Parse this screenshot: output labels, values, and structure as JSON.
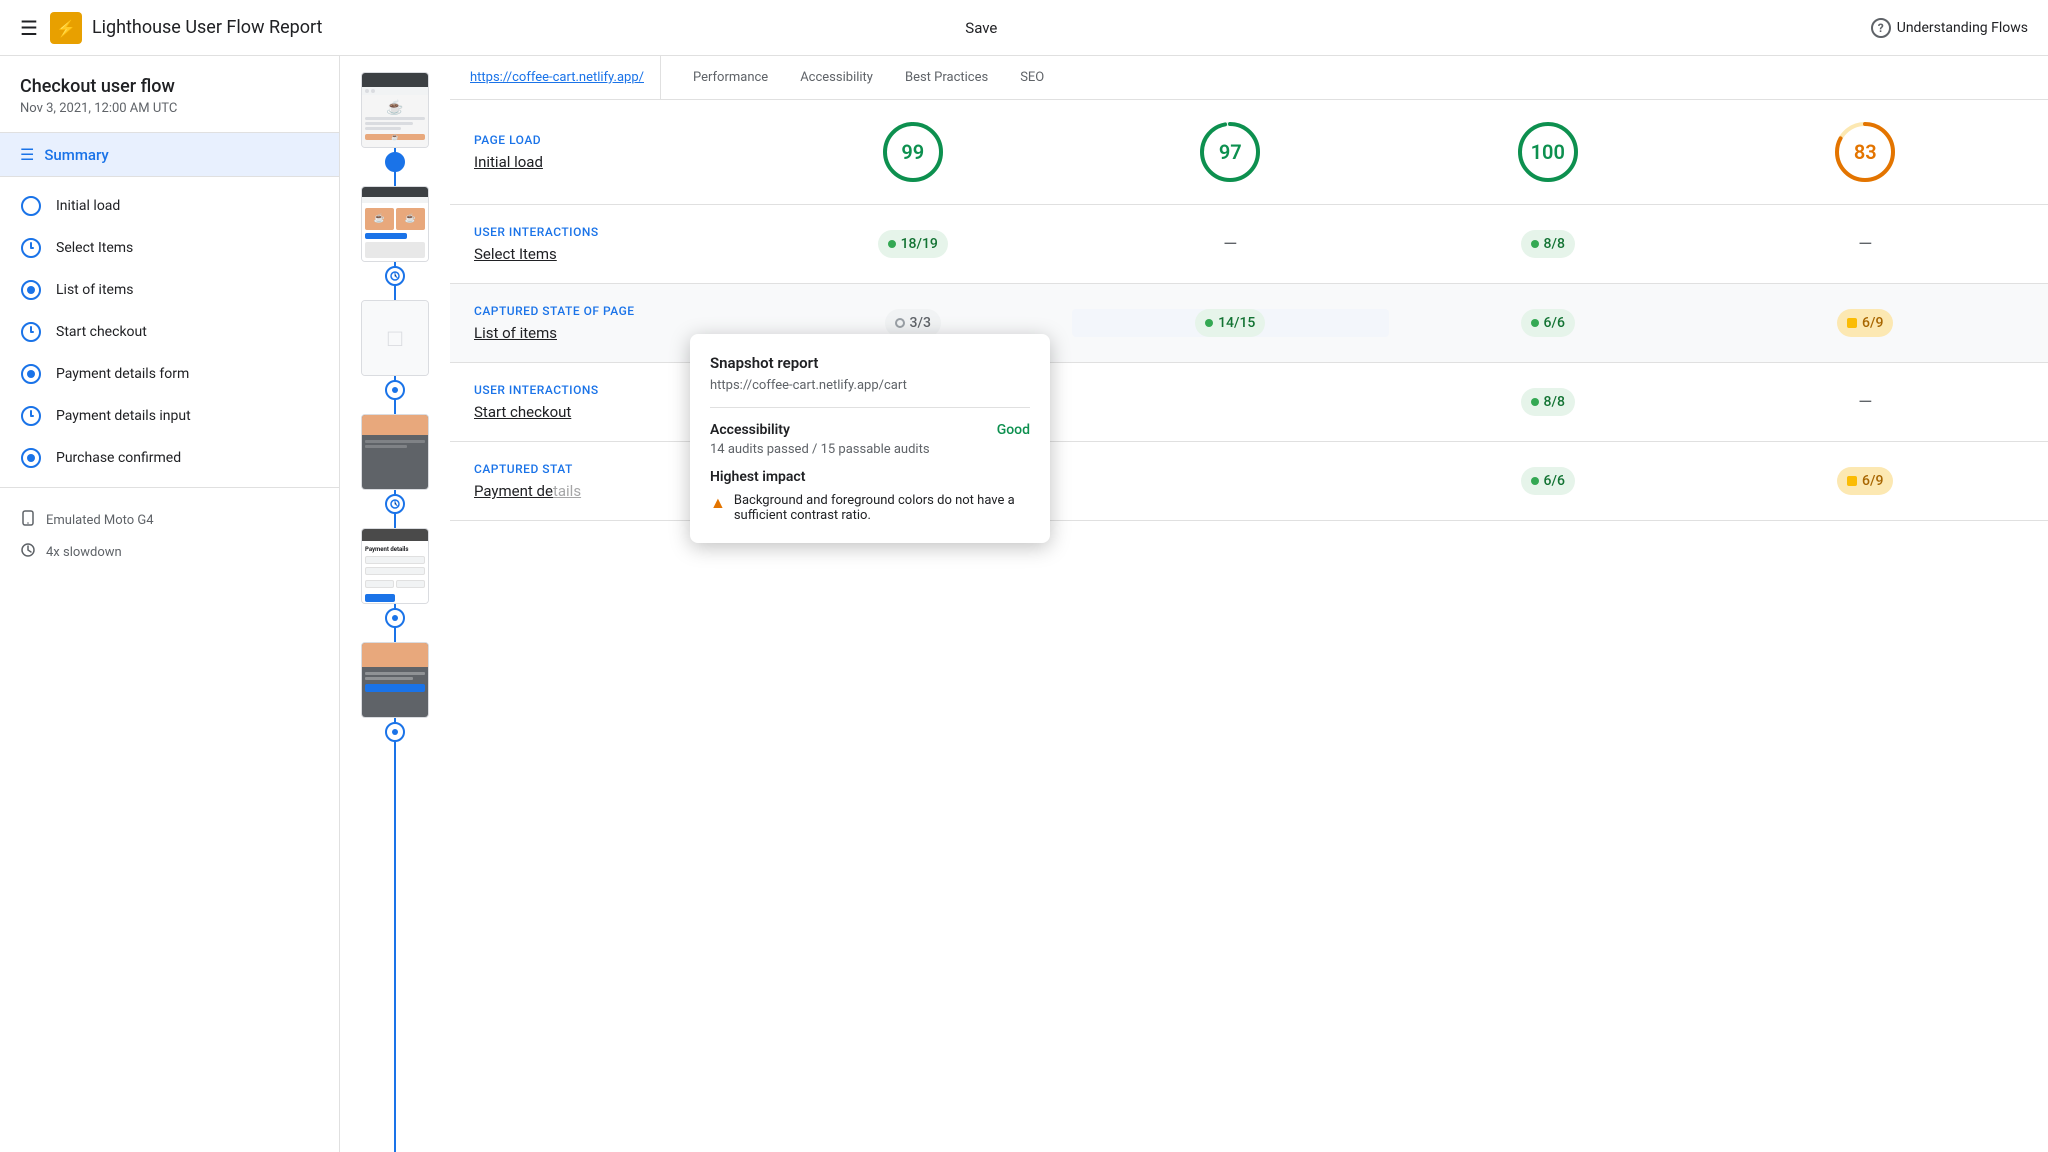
{
  "header": {
    "menu_label": "☰",
    "logo_emoji": "🏠",
    "title": "Lighthouse User Flow Report",
    "save_label": "Save",
    "help_icon": "?",
    "help_label": "Understanding Flows"
  },
  "sidebar": {
    "flow_title": "Checkout user flow",
    "date": "Nov 3, 2021, 12:00 AM UTC",
    "summary_label": "Summary",
    "steps": [
      {
        "id": "initial-load",
        "label": "Initial load",
        "type": "circle"
      },
      {
        "id": "select-items",
        "label": "Select Items",
        "type": "clock"
      },
      {
        "id": "list-of-items",
        "label": "List of items",
        "type": "snap"
      },
      {
        "id": "start-checkout",
        "label": "Start checkout",
        "type": "clock"
      },
      {
        "id": "payment-details-form",
        "label": "Payment details form",
        "type": "snap"
      },
      {
        "id": "payment-details-input",
        "label": "Payment details input",
        "type": "clock"
      },
      {
        "id": "purchase-confirmed",
        "label": "Purchase confirmed",
        "type": "snap"
      }
    ],
    "device_label": "Emulated Moto G4",
    "slowdown_label": "4x slowdown"
  },
  "tabs": {
    "url": "https://coffee-cart.netlify.app/",
    "items": [
      "Performance",
      "Accessibility",
      "Best Practices",
      "SEO"
    ]
  },
  "sections": [
    {
      "id": "page-load-initial",
      "type_label": "Page load",
      "name": "Initial load",
      "scores": [
        {
          "type": "circle",
          "value": 99,
          "color": "green"
        },
        {
          "type": "circle",
          "value": 97,
          "color": "green"
        },
        {
          "type": "circle",
          "value": 100,
          "color": "green"
        },
        {
          "type": "circle",
          "value": 83,
          "color": "orange"
        }
      ]
    },
    {
      "id": "user-interactions-select",
      "type_label": "User interactions",
      "name": "Select Items",
      "scores": [
        {
          "type": "badge",
          "value": "18/19",
          "color": "green"
        },
        {
          "type": "dash"
        },
        {
          "type": "badge",
          "value": "8/8",
          "color": "green"
        },
        {
          "type": "dash"
        }
      ]
    },
    {
      "id": "captured-state-list",
      "type_label": "Captured state of page",
      "name": "List of items",
      "scores": [
        {
          "type": "badge-gray",
          "value": "3/3"
        },
        {
          "type": "badge",
          "value": "14/15",
          "color": "green"
        },
        {
          "type": "badge",
          "value": "6/6",
          "color": "green"
        },
        {
          "type": "badge",
          "value": "6/9",
          "color": "orange"
        }
      ]
    },
    {
      "id": "user-interactions-checkout",
      "type_label": "User interactions",
      "name": "Start checkout",
      "scores": [
        {
          "type": "hidden"
        },
        {
          "type": "hidden"
        },
        {
          "type": "badge",
          "value": "8/8",
          "color": "green"
        },
        {
          "type": "dash"
        }
      ]
    },
    {
      "id": "captured-state-payment",
      "type_label": "Captured state",
      "name": "Payment details",
      "scores": [
        {
          "type": "hidden"
        },
        {
          "type": "hidden"
        },
        {
          "type": "badge",
          "value": "6/6",
          "color": "green"
        },
        {
          "type": "badge",
          "value": "6/9",
          "color": "orange"
        }
      ]
    }
  ],
  "tooltip": {
    "title": "Snapshot report",
    "url": "https://coffee-cart.netlify.app/cart",
    "accessibility_label": "Accessibility",
    "accessibility_status": "Good",
    "accessibility_desc": "14 audits passed / 15 passable audits",
    "highest_impact_label": "Highest impact",
    "impact_items": [
      {
        "icon": "warning",
        "text": "Background and foreground colors do not have a sufficient contrast ratio."
      }
    ]
  },
  "colors": {
    "blue": "#1a73e8",
    "green": "#0d904f",
    "orange": "#e37400",
    "green_light": "#e6f4ea",
    "orange_light": "#fce8b2"
  }
}
